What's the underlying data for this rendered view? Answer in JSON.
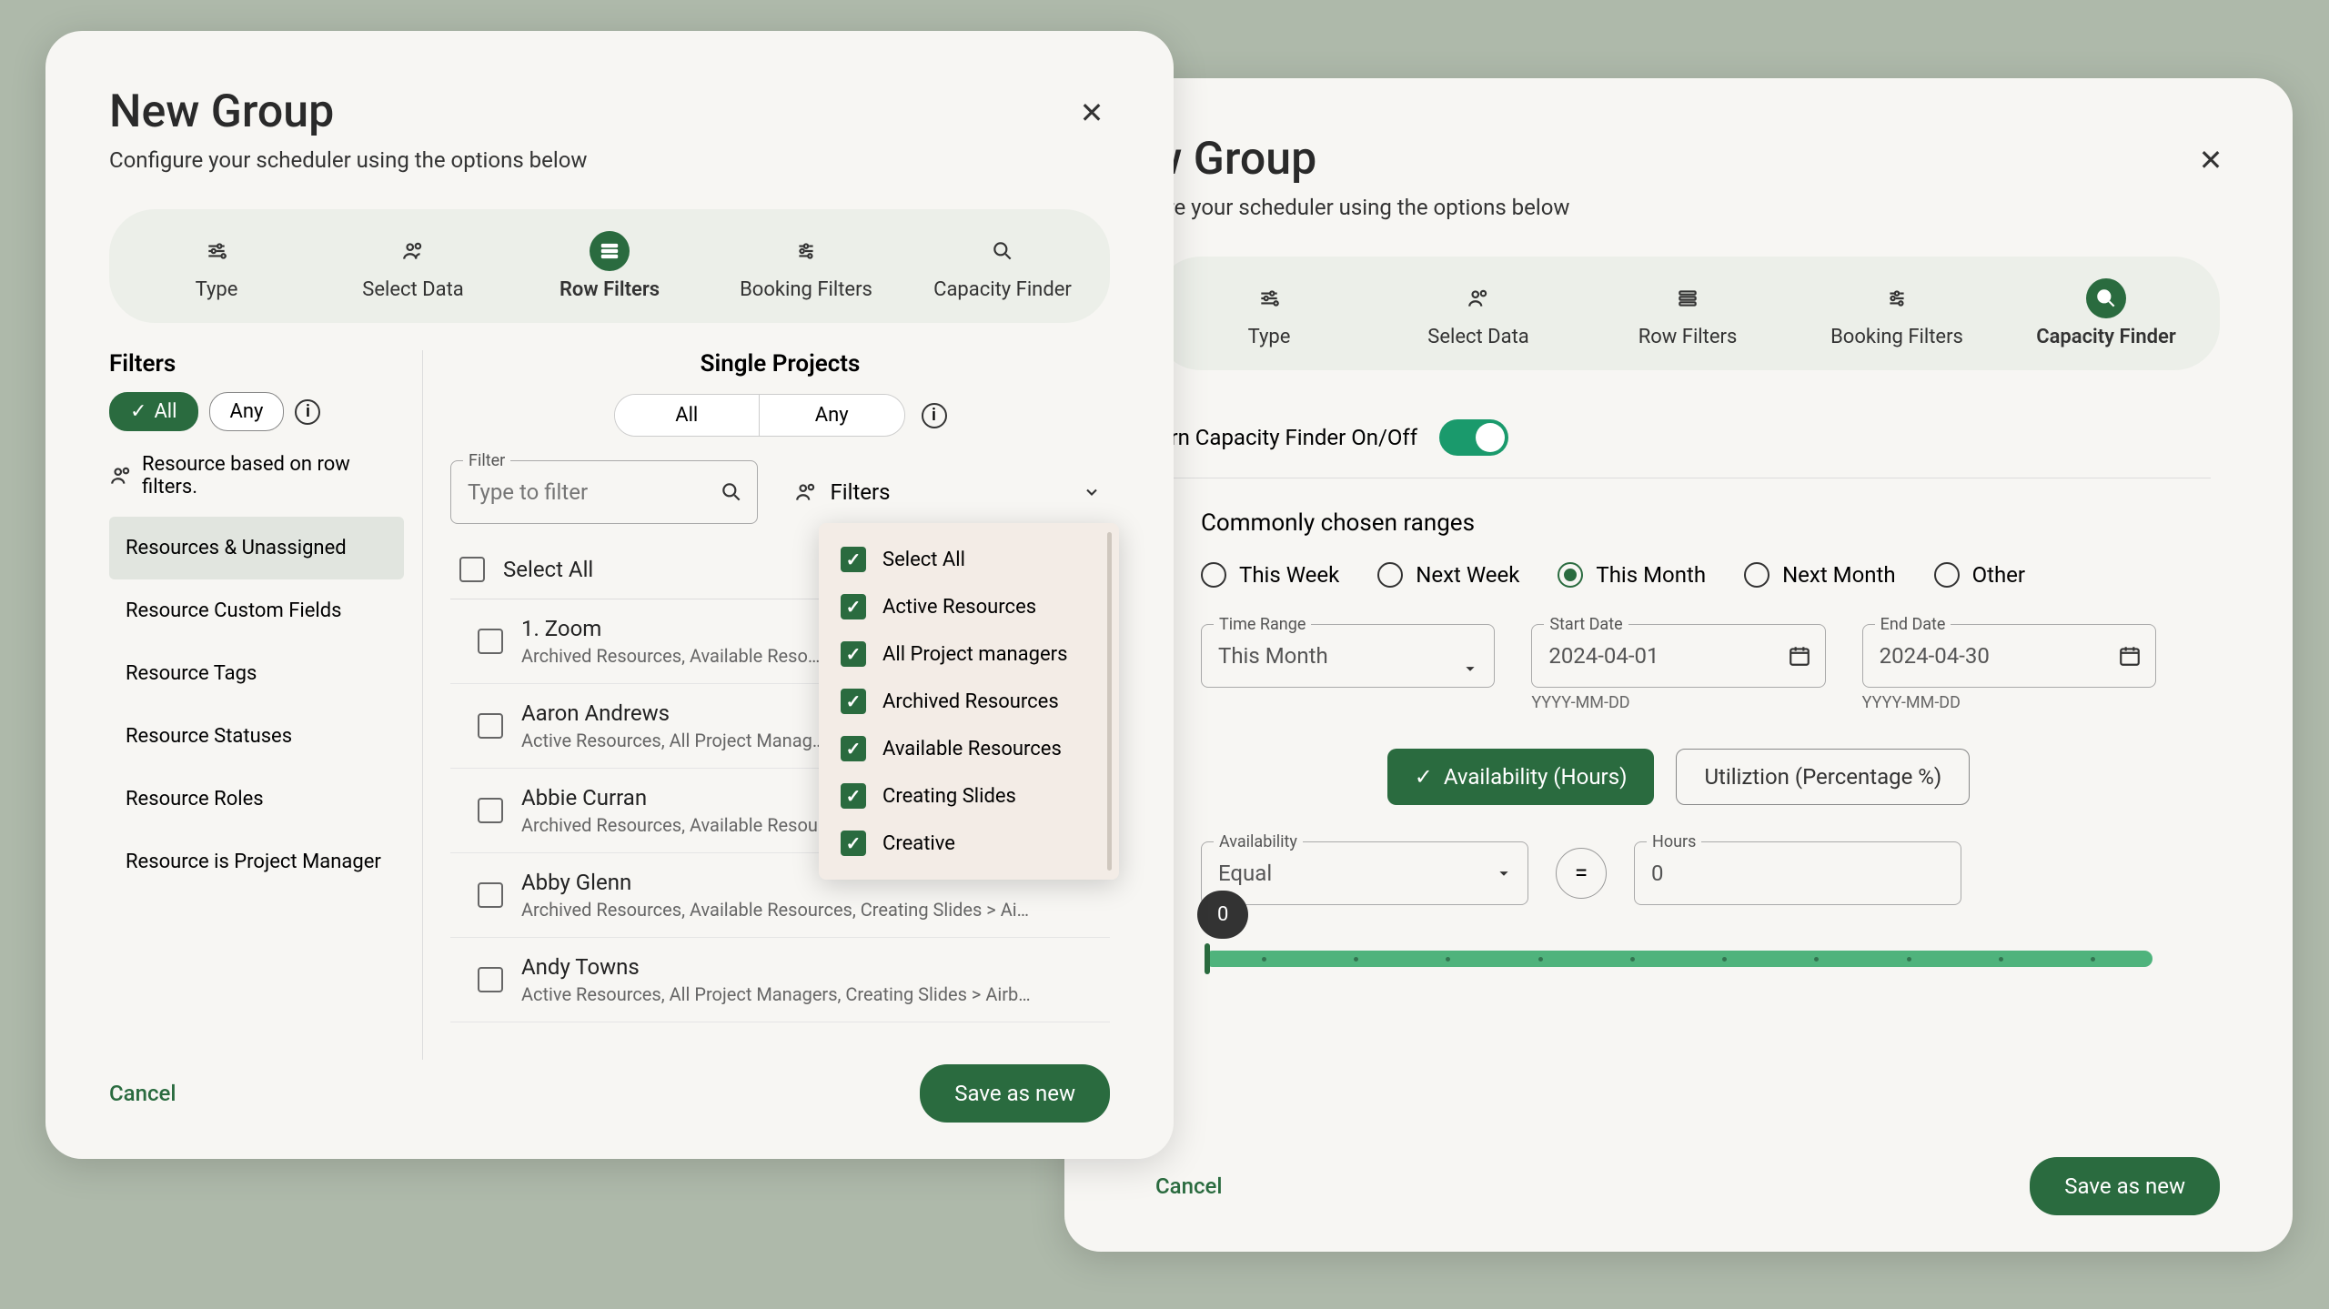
{
  "dialog": {
    "title": "New Group",
    "subtitle": "Configure your scheduler using the options below"
  },
  "tabs": [
    "Type",
    "Select Data",
    "Row Filters",
    "Booking Filters",
    "Capacity Finder"
  ],
  "left": {
    "filters_title": "Filters",
    "chip_all": "All",
    "chip_any": "Any",
    "resource_note": "Resource based on row filters.",
    "categories": [
      "Resources & Unassigned",
      "Resource Custom Fields",
      "Resource Tags",
      "Resource Statuses",
      "Resource Roles",
      "Resource is Project Manager"
    ],
    "projects_title": "Single Projects",
    "seg_all": "All",
    "seg_any": "Any",
    "filter_label": "Filter",
    "filter_placeholder": "Type to filter",
    "filters_dd_label": "Filters",
    "select_all": "Select All",
    "resources": [
      {
        "name": "1. Zoom",
        "sub": "Archived Resources, Available Reso…"
      },
      {
        "name": "Aaron Andrews",
        "sub": "Active Resources, All Project Manag…"
      },
      {
        "name": "Abbie Curran",
        "sub": "Archived Resources, Available Resources"
      },
      {
        "name": "Abby Glenn",
        "sub": "Archived Resources, Available Resources, Creating Slides > Airbus,…"
      },
      {
        "name": "Andy Towns",
        "sub": "Active Resources, All Project Managers, Creating Slides > Airbus, Creativ…"
      }
    ],
    "dropdown": [
      "Select All",
      "Active Resources",
      "All Project managers",
      "Archived Resources",
      "Available Resources",
      "Creating Slides",
      "Creative"
    ]
  },
  "right": {
    "toggle_label": "Turn Capacity Finder On/Off",
    "ranges_title": "Commonly chosen ranges",
    "ranges": [
      "This Week",
      "Next Week",
      "This Month",
      "Next Month",
      "Other"
    ],
    "time_range_label": "Time Range",
    "time_range_value": "This Month",
    "start_date_label": "Start Date",
    "start_date_value": "2024-04-01",
    "end_date_label": "End Date",
    "end_date_value": "2024-04-30",
    "date_helper": "YYYY-MM-DD",
    "mode_availability": "Availability (Hours)",
    "mode_utilization": "Utiliztion (Percentage %)",
    "availability_label": "Availability",
    "availability_value": "Equal",
    "hours_label": "Hours",
    "hours_value": "0",
    "slider_value": "0"
  },
  "footer": {
    "cancel": "Cancel",
    "save": "Save as new"
  }
}
